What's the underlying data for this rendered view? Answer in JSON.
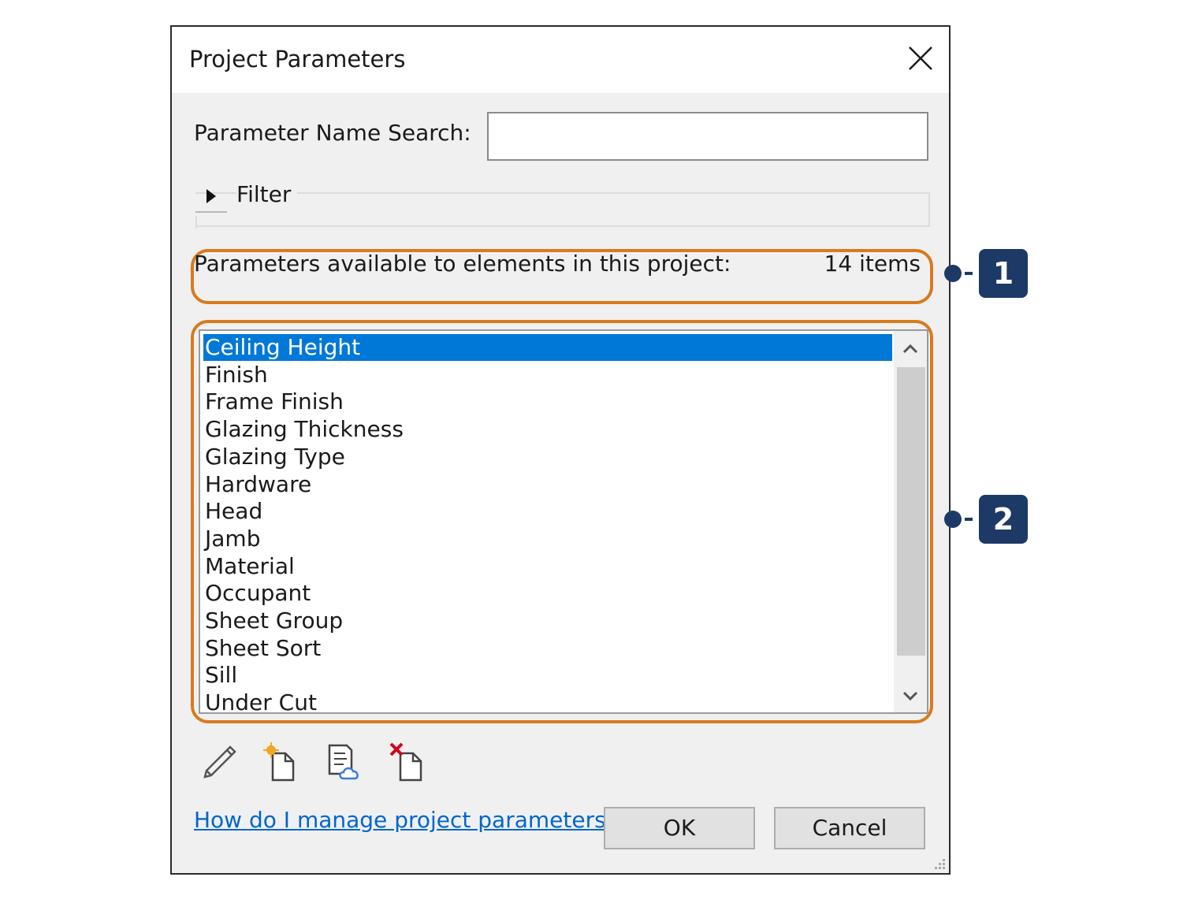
{
  "dialog": {
    "title": "Project Parameters",
    "close_icon": "close-icon"
  },
  "search": {
    "label": "Parameter Name Search:",
    "value": "",
    "placeholder": ""
  },
  "filter": {
    "label": "Filter",
    "expanded": false
  },
  "parameters": {
    "header_label": "Parameters available to elements in this project:",
    "count_label": "14 items",
    "selected_index": 0,
    "items": [
      "Ceiling Height",
      "Finish",
      "Frame Finish",
      "Glazing Thickness",
      "Glazing Type",
      "Hardware",
      "Head",
      "Jamb",
      "Material",
      "Occupant",
      "Sheet Group",
      "Sheet Sort",
      "Sill",
      "Under Cut"
    ]
  },
  "toolbar": {
    "icons": [
      "pencil-edit-icon",
      "new-parameter-icon",
      "export-parameters-icon",
      "delete-parameter-icon"
    ]
  },
  "footer": {
    "help_link": "How do I manage project parameters?",
    "ok_label": "OK",
    "cancel_label": "Cancel"
  },
  "callouts": [
    {
      "number": "1"
    },
    {
      "number": "2"
    }
  ],
  "colors": {
    "selection": "#0078d7",
    "callout_border": "#d87a1e",
    "badge": "#1d3a66",
    "link": "#0066cc"
  }
}
